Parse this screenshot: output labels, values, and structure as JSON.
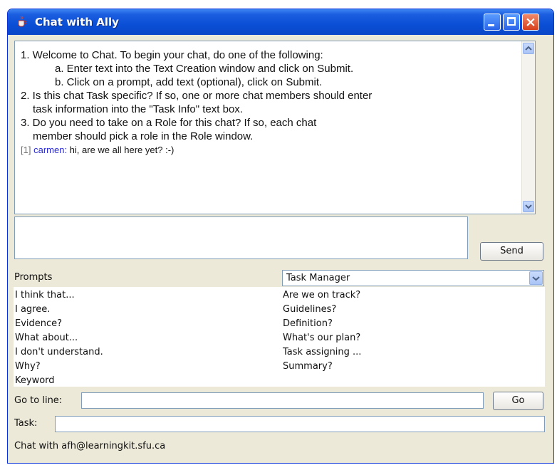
{
  "window": {
    "title": "Chat with Ally",
    "controls": {
      "minimize": "minimize-icon",
      "maximize": "maximize-icon",
      "close": "close-icon"
    },
    "accent": "#0a4fd6"
  },
  "transcript": {
    "lines": [
      "1. Welcome to Chat. To begin your chat, do one of the following:",
      "a. Enter text into the Text Creation window and click on Submit.",
      "b. Click on a prompt, add text (optional), click on Submit.",
      "2. Is this chat Task specific? If so, one or more chat members should enter",
      "task information into the \"Task Info\" text box.",
      "3. Do you need to take on a Role for this chat? If so, each chat",
      "member should pick a role in the Role window."
    ],
    "messages": [
      {
        "index": "[1]",
        "user": "carmen:",
        "text": " hi, are we all here yet? :-)"
      }
    ]
  },
  "compose": {
    "value": "",
    "send_label": "Send"
  },
  "prompts": {
    "label": "Prompts",
    "role_selected": "Task Manager",
    "left": [
      "I think that...",
      "I agree.",
      "Evidence?",
      "What about...",
      "I don't understand.",
      "Why?",
      "Keyword"
    ],
    "right": [
      "Are we on track?",
      "Guidelines?",
      "Definition?",
      "What's our plan?",
      "Task assigning ...",
      "Summary?"
    ]
  },
  "goto": {
    "label": "Go to line:",
    "value": "",
    "button_label": "Go"
  },
  "task": {
    "label": "Task:",
    "value": ""
  },
  "status": {
    "text": "Chat with afh@learningkit.sfu.ca"
  }
}
